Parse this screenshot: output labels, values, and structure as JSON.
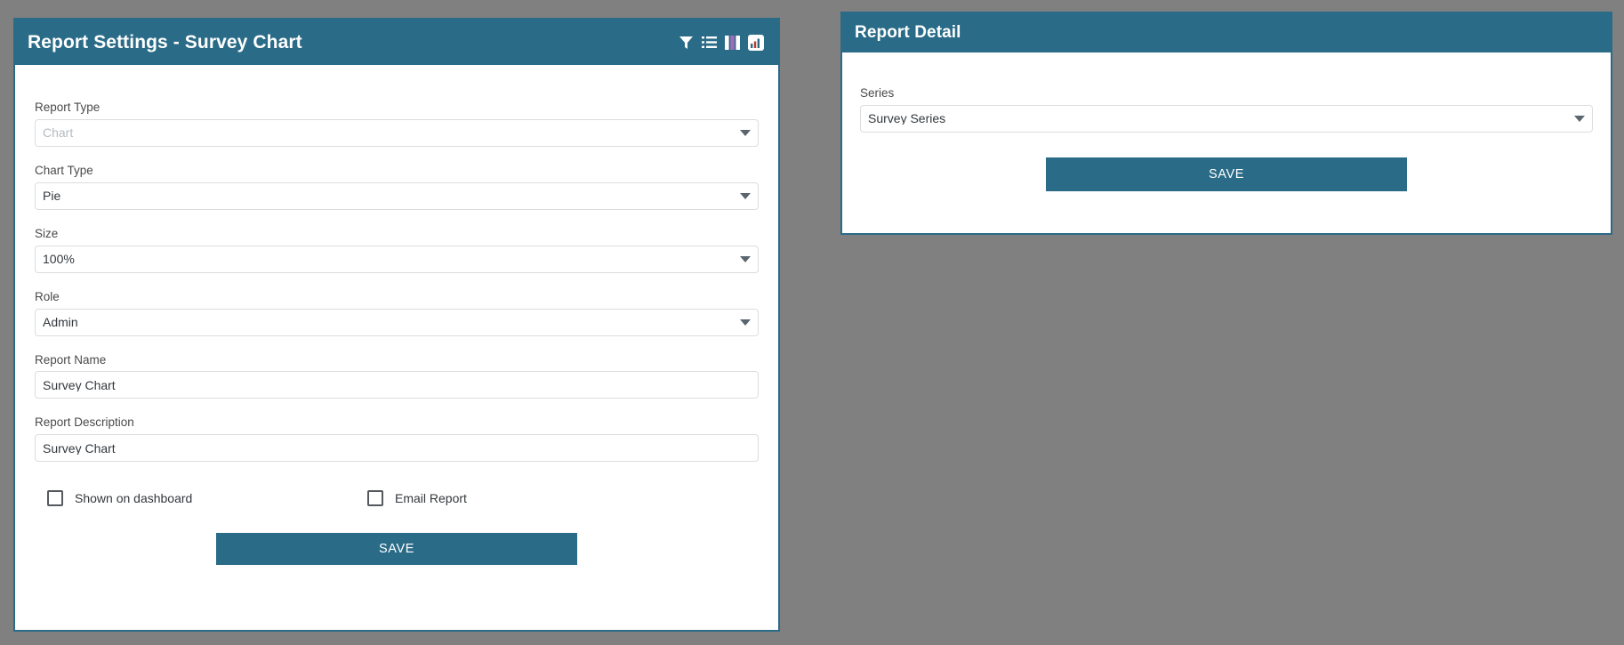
{
  "report_settings_panel": {
    "title": "Report Settings - Survey Chart",
    "header_icons": [
      {
        "name": "filter-icon",
        "label": "Filter"
      },
      {
        "name": "list-icon",
        "label": "List"
      },
      {
        "name": "columns-icon",
        "label": "Columns"
      },
      {
        "name": "chart-icon",
        "label": "Chart"
      }
    ],
    "fields": {
      "report_type": {
        "label": "Report Type",
        "value": "Chart",
        "disabled": true
      },
      "chart_type": {
        "label": "Chart Type",
        "value": "Pie"
      },
      "size": {
        "label": "Size",
        "value": "100%"
      },
      "role": {
        "label": "Role",
        "value": "Admin"
      },
      "report_name": {
        "label": "Report Name",
        "value": "Survey Chart",
        "placeholder": "Report Name"
      },
      "report_description": {
        "label": "Report Description",
        "value": "Survey Chart",
        "placeholder": "Report Description"
      }
    },
    "checkboxes": [
      {
        "label": "Shown on dashboard",
        "checked": false
      },
      {
        "label": "Email Report",
        "checked": false
      }
    ],
    "save_label": "SAVE"
  },
  "report_detail_panel": {
    "title": "Report Detail",
    "fields": {
      "series": {
        "label": "Series",
        "value": "Survey Series"
      }
    },
    "save_label": "SAVE"
  },
  "colors": {
    "accent": "#2a6b87",
    "page_background": "#808080",
    "panel_background": "#ffffff",
    "field_border": "#dadde0",
    "text": "#33383d",
    "muted_text": "#b6bbc0",
    "checkbox_border": "#55595d"
  }
}
